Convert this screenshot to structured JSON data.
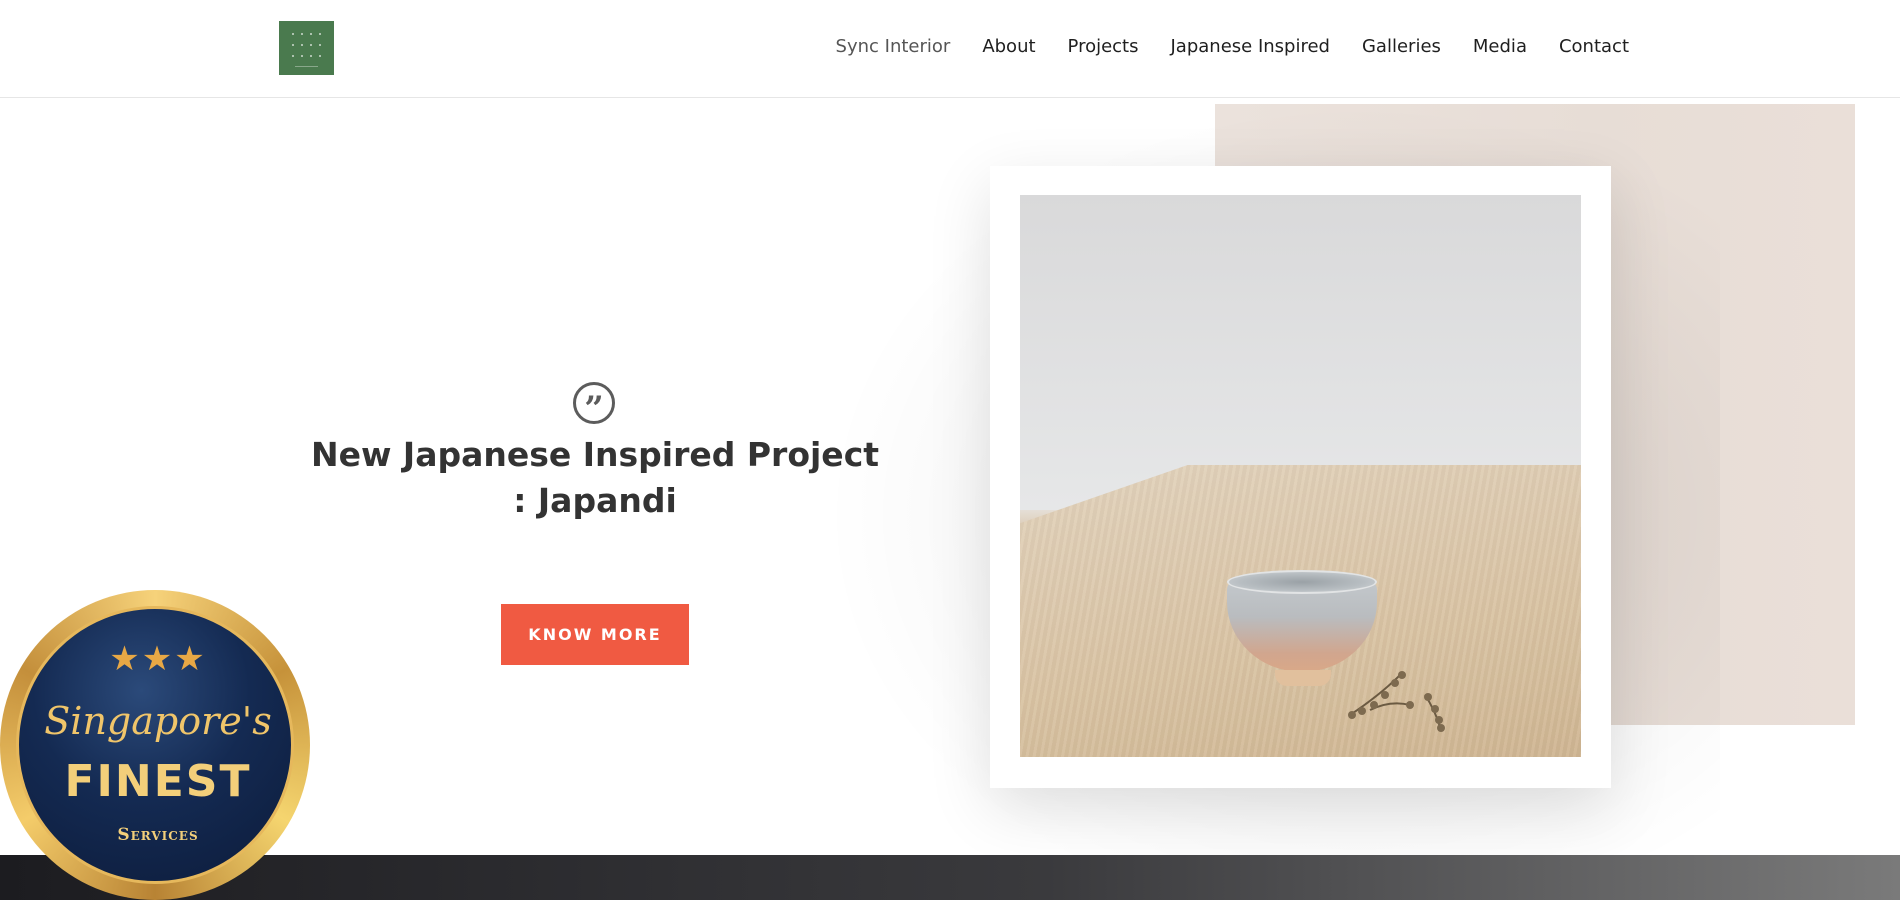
{
  "header": {
    "logo_icon": "sync-interior-logo",
    "nav": [
      {
        "label": "Sync Interior",
        "active": true
      },
      {
        "label": "About"
      },
      {
        "label": "Projects"
      },
      {
        "label": "Japanese Inspired"
      },
      {
        "label": "Galleries"
      },
      {
        "label": "Media"
      },
      {
        "label": "Contact"
      }
    ]
  },
  "hero": {
    "quote_icon": "quote-icon",
    "quote_glyph": "”",
    "title": "New Japanese Inspired Project : Japandi",
    "button_label": "KNOW MORE",
    "image_alt": "Ceramic cup on a wooden table"
  },
  "badge": {
    "stars": "★★★",
    "script": "Singapore's",
    "headline": "FINEST",
    "subline": "Services"
  },
  "colors": {
    "accent": "#f05a42",
    "logo": "#4a7a4e",
    "beige": "#e9dfd8",
    "text": "#333333"
  }
}
